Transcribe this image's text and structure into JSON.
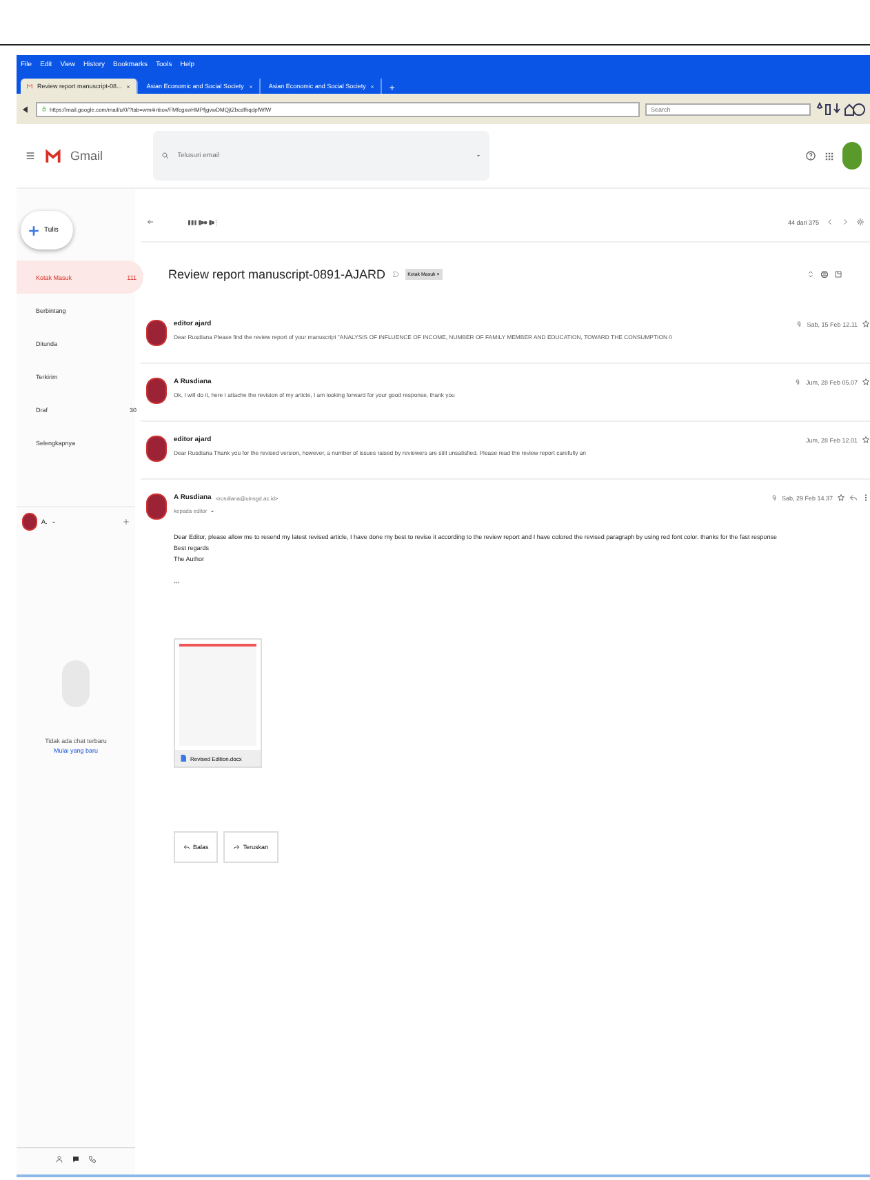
{
  "menu": [
    "File",
    "Edit",
    "View",
    "History",
    "Bookmarks",
    "Tools",
    "Help"
  ],
  "tabs": [
    {
      "label": "Review report manuscript-08...",
      "selected": true
    },
    {
      "label": "Asian Economic and Social Society",
      "selected": false
    },
    {
      "label": "Asian Economic and Social Society",
      "selected": false
    }
  ],
  "new_tab": "+",
  "address": "https://mail.google.com/mail/u/0/?tab=wm#inbox/FMfcgxwHMPfjgvwDMQjtZbcdfhqdpfWfW",
  "browser_search": {
    "placeholder": "Search"
  },
  "gmail": {
    "logo": "Gmail",
    "search": {
      "placeholder": "Telusuri email"
    }
  },
  "compose": "Tulis",
  "nav": [
    {
      "label": "Kotak Masuk",
      "count": "111",
      "selected": true
    },
    {
      "label": "Berbintang",
      "selected": false
    },
    {
      "label": "Ditunda",
      "selected": false
    },
    {
      "label": "Terkirim",
      "selected": false
    },
    {
      "label": "Draf",
      "count": "30",
      "selected": false
    },
    {
      "label": "Selengkapnya",
      "selected": false
    }
  ],
  "account": {
    "name": "A."
  },
  "chat": {
    "empty": "Tidak ada chat terbaru",
    "start": "Mulai yang baru"
  },
  "pager": "44 dari 375",
  "subject": "Review report manuscript-0891-AJARD",
  "label_chip": "Kotak Masuk ×",
  "messages": [
    {
      "sender": "editor ajard",
      "snippet": "Dear Rusdiana Please find the review report of your manuscript \"ANALYSIS OF INFLUENCE OF INCOME, NUMBER OF FAMILY MEMBER AND EDUCATION, TOWARD THE CONSUMPTION 0",
      "date": "Sab, 15 Feb 12.11",
      "attachment": true
    },
    {
      "sender": "A Rusdiana",
      "snippet": "Ok, I will do it, here I attache the revision of my article, I am looking forward for your good response, thank you",
      "date": "Jum, 28 Feb 05.07",
      "attachment": true
    },
    {
      "sender": "editor ajard",
      "snippet": "Dear Rusdiana Thank you for the revised version, however, a number of issues raised by reviewers are still unsatisfied. Please read the review report carefully an",
      "date": "Jum, 28 Feb 12.01",
      "attachment": false
    }
  ],
  "open_message": {
    "sender": "A Rusdiana",
    "email": "<rusdiana@uinsgd.ac.id>",
    "to": "kepada editor",
    "date": "Sab, 29 Feb 14.37",
    "body": [
      "Dear Editor, please allow me to resend my latest revised article, I have done my best to revise it according to the review report and I have colored the revised paragraph by using red font color. thanks for the fast response",
      "Best regards",
      "The Author"
    ],
    "more": "•••",
    "file": "Revised Edition.docx"
  },
  "actions": [
    "Balas",
    "Teruskan"
  ]
}
